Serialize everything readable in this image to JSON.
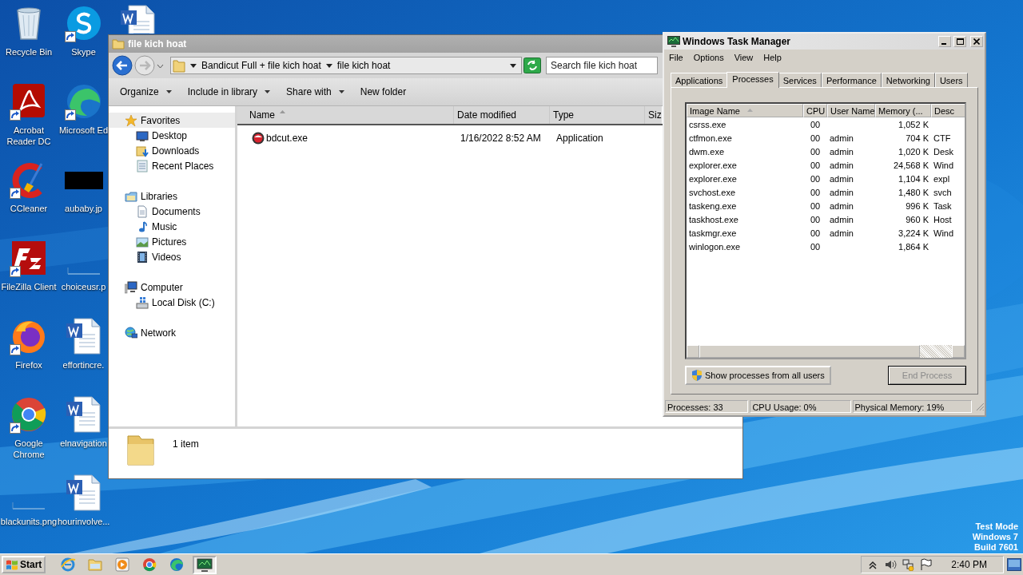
{
  "desktop_icons": [
    {
      "label": "Recycle Bin",
      "kind": "trash",
      "shortcut": false
    },
    {
      "label": "Acrobat Reader DC",
      "kind": "acrobat",
      "shortcut": true
    },
    {
      "label": "CCleaner",
      "kind": "ccleaner",
      "shortcut": true
    },
    {
      "label": "FileZilla Client",
      "kind": "filezilla",
      "shortcut": true
    },
    {
      "label": "Firefox",
      "kind": "firefox",
      "shortcut": true
    },
    {
      "label": "Google Chrome",
      "kind": "chrome",
      "shortcut": true
    },
    {
      "label": "blackunits.png",
      "kind": "blank",
      "shortcut": false
    },
    {
      "label": "Skype",
      "kind": "skype",
      "shortcut": true
    },
    {
      "label": "Microsoft Ed",
      "kind": "edge",
      "shortcut": true
    },
    {
      "label": "aubaby.jp",
      "kind": "dark_image",
      "shortcut": false
    },
    {
      "label": "choiceusr.p",
      "kind": "blank",
      "shortcut": false
    },
    {
      "label": "effortincre.",
      "kind": "word",
      "shortcut": false
    },
    {
      "label": "elnavigation",
      "kind": "word",
      "shortcut": false
    },
    {
      "label": "hourinvolve...",
      "kind": "word",
      "shortcut": false
    },
    {
      "kind": "word",
      "shortcut": false
    }
  ],
  "explorer": {
    "title": "file kich hoat",
    "breadcrumbs": [
      "Bandicut Full + file kich hoat",
      "file kich hoat"
    ],
    "search": {
      "placeholder": "Search file kich hoat"
    },
    "toolbar": [
      {
        "label": "Organize",
        "dropdown": true
      },
      {
        "label": "Include in library",
        "dropdown": true
      },
      {
        "label": "Share with",
        "dropdown": true
      },
      {
        "label": "New folder",
        "dropdown": false
      }
    ],
    "nav": [
      {
        "label": "Favorites",
        "kind": "star",
        "selected": true,
        "children": [
          {
            "label": "Desktop",
            "kind": "desktop",
            "selected": false
          },
          {
            "label": "Downloads",
            "kind": "downloads",
            "selected": false
          },
          {
            "label": "Recent Places",
            "kind": "recent",
            "selected": false
          }
        ]
      },
      {
        "label": "Libraries",
        "kind": "libraries",
        "selected": false,
        "children": [
          {
            "label": "Documents",
            "kind": "documents",
            "selected": false
          },
          {
            "label": "Music",
            "kind": "music",
            "selected": false
          },
          {
            "label": "Pictures",
            "kind": "pictures",
            "selected": false
          },
          {
            "label": "Videos",
            "kind": "videos",
            "selected": false
          }
        ]
      },
      {
        "label": "Computer",
        "kind": "computer",
        "selected": false,
        "children": [
          {
            "label": "Local Disk (C:)",
            "kind": "disk",
            "selected": false
          }
        ]
      },
      {
        "label": "Network",
        "kind": "network",
        "selected": false
      }
    ],
    "columns": [
      {
        "label": "Name",
        "sorted": true
      },
      {
        "label": "Date modified",
        "sorted": false
      },
      {
        "label": "Type",
        "sorted": false
      },
      {
        "label": "Siz",
        "sorted": false
      }
    ],
    "files": [
      {
        "name": "bdcut.exe",
        "date_modified": "1/16/2022 8:52 AM",
        "type": "Application"
      }
    ],
    "details": "1 item"
  },
  "task_manager": {
    "title": "Windows Task Manager",
    "menu": [
      "File",
      "Options",
      "View",
      "Help"
    ],
    "tabs": [
      {
        "label": "Applications",
        "selected": false
      },
      {
        "label": "Processes",
        "selected": true
      },
      {
        "label": "Services",
        "selected": false
      },
      {
        "label": "Performance",
        "selected": false
      },
      {
        "label": "Networking",
        "selected": false
      },
      {
        "label": "Users",
        "selected": false
      }
    ],
    "columns": [
      {
        "label": "Image Name",
        "sorted": true
      },
      {
        "label": "CPU",
        "sorted": false
      },
      {
        "label": "User Name",
        "sorted": false
      },
      {
        "label": "Memory (...",
        "sorted": false
      },
      {
        "label": "Desc",
        "sorted": false
      }
    ],
    "rows": [
      {
        "image_name": "csrss.exe",
        "cpu": "00",
        "memory": "1,052 K"
      },
      {
        "image_name": "ctfmon.exe",
        "cpu": "00",
        "user_name": "admin",
        "memory": "704 K",
        "description": "CTF"
      },
      {
        "image_name": "dwm.exe",
        "cpu": "00",
        "user_name": "admin",
        "memory": "1,020 K",
        "description": "Desk"
      },
      {
        "image_name": "explorer.exe",
        "cpu": "00",
        "user_name": "admin",
        "memory": "24,568 K",
        "description": "Wind"
      },
      {
        "image_name": "explorer.exe",
        "cpu": "00",
        "user_name": "admin",
        "memory": "1,104 K",
        "description": "expl"
      },
      {
        "image_name": "svchost.exe",
        "cpu": "00",
        "user_name": "admin",
        "memory": "1,480 K",
        "description": "svch"
      },
      {
        "image_name": "taskeng.exe",
        "cpu": "00",
        "user_name": "admin",
        "memory": "996 K",
        "description": "Task"
      },
      {
        "image_name": "taskhost.exe",
        "cpu": "00",
        "user_name": "admin",
        "memory": "960 K",
        "description": "Host"
      },
      {
        "image_name": "taskmgr.exe",
        "cpu": "00",
        "user_name": "admin",
        "memory": "3,224 K",
        "description": "Wind"
      },
      {
        "image_name": "winlogon.exe",
        "cpu": "00",
        "memory": "1,864 K"
      }
    ],
    "buttons": [
      {
        "label": "Show processes from all users",
        "disabled": false,
        "shield": true
      },
      {
        "label": "End Process",
        "disabled": true,
        "shield": false
      }
    ],
    "status_bar": [
      "Processes: 33",
      "CPU Usage: 0%",
      "Physical Memory: 19%"
    ]
  },
  "os_notice": [
    "Test Mode",
    "Windows 7",
    "Build 7601"
  ],
  "taskbar": {
    "start": "Start",
    "items": [
      {
        "kind": "ie",
        "active": false
      },
      {
        "kind": "folder",
        "active": false
      },
      {
        "kind": "media",
        "active": false
      },
      {
        "kind": "chrome",
        "active": false
      },
      {
        "kind": "edge",
        "active": false
      },
      {
        "kind": "monitor",
        "active": true
      }
    ],
    "tray": [
      {
        "kind": "caret"
      },
      {
        "kind": "speaker"
      },
      {
        "kind": "network"
      },
      {
        "kind": "flag"
      }
    ],
    "clock": "2:40 PM"
  }
}
